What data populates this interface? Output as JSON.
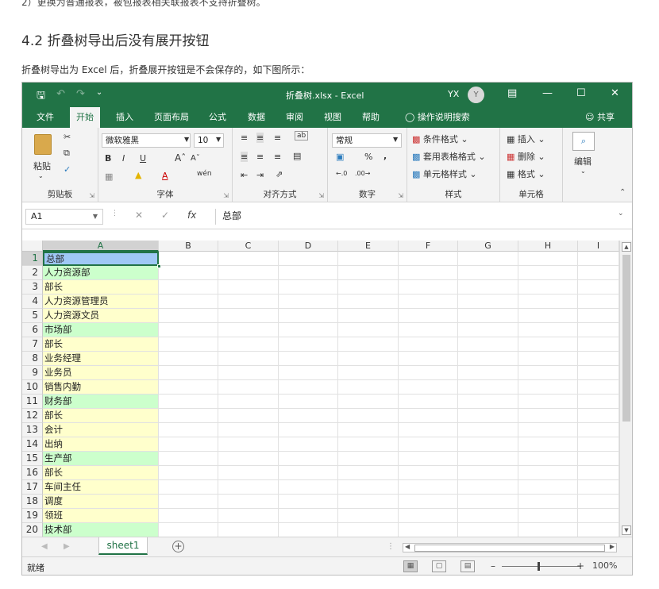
{
  "article": {
    "top_fragment": "2）更换为普通报表，被包报表相关联报表不支持折叠树。",
    "heading": "4.2 折叠树导出后没有展开按钮",
    "paragraph": "折叠树导出为 Excel 后，折叠展开按钮是不会保存的，如下图所示："
  },
  "excel": {
    "title": "折叠树.xlsx  -  Excel",
    "user_initials": "YX",
    "avatar_letter": "Y",
    "tabs": [
      "文件",
      "开始",
      "插入",
      "页面布局",
      "公式",
      "数据",
      "审阅",
      "视图",
      "帮助"
    ],
    "active_tab": "开始",
    "tell_me": "操作说明搜索",
    "share": "共享",
    "ribbon": {
      "clipboard": {
        "paste": "粘贴",
        "label": "剪贴板"
      },
      "font": {
        "name": "微软雅黑",
        "size": "10",
        "label": "字体"
      },
      "alignment": {
        "label": "对齐方式"
      },
      "number": {
        "format": "常规",
        "label": "数字"
      },
      "styles": {
        "conditional": "条件格式",
        "table": "套用表格格式",
        "cell_styles": "单元格样式",
        "label": "样式"
      },
      "cells": {
        "insert": "插入",
        "delete": "删除",
        "format": "格式",
        "label": "单元格"
      },
      "editing": {
        "label": "编辑"
      }
    },
    "namebox": "A1",
    "formula": "总部",
    "columns": [
      "A",
      "B",
      "C",
      "D",
      "E",
      "F",
      "G",
      "H",
      "I"
    ],
    "rows": [
      {
        "num": "1",
        "value": "总部",
        "fill": "active"
      },
      {
        "num": "2",
        "value": "人力资源部",
        "fill": "green"
      },
      {
        "num": "3",
        "value": "部长",
        "fill": "yellow"
      },
      {
        "num": "4",
        "value": "人力资源管理员",
        "fill": "yellow"
      },
      {
        "num": "5",
        "value": "人力资源文员",
        "fill": "yellow"
      },
      {
        "num": "6",
        "value": "市场部",
        "fill": "green"
      },
      {
        "num": "7",
        "value": "部长",
        "fill": "yellow"
      },
      {
        "num": "8",
        "value": "业务经理",
        "fill": "yellow"
      },
      {
        "num": "9",
        "value": "业务员",
        "fill": "yellow"
      },
      {
        "num": "10",
        "value": "销售内勤",
        "fill": "yellow"
      },
      {
        "num": "11",
        "value": "财务部",
        "fill": "green"
      },
      {
        "num": "12",
        "value": "部长",
        "fill": "yellow"
      },
      {
        "num": "13",
        "value": "会计",
        "fill": "yellow"
      },
      {
        "num": "14",
        "value": "出纳",
        "fill": "yellow"
      },
      {
        "num": "15",
        "value": "生产部",
        "fill": "green"
      },
      {
        "num": "16",
        "value": "部长",
        "fill": "yellow"
      },
      {
        "num": "17",
        "value": "车间主任",
        "fill": "yellow"
      },
      {
        "num": "18",
        "value": "调度",
        "fill": "yellow"
      },
      {
        "num": "19",
        "value": "领班",
        "fill": "yellow"
      },
      {
        "num": "20",
        "value": "技术部",
        "fill": "green"
      }
    ],
    "sheet_tab": "sheet1",
    "status": "就绪",
    "zoom": "100%"
  }
}
